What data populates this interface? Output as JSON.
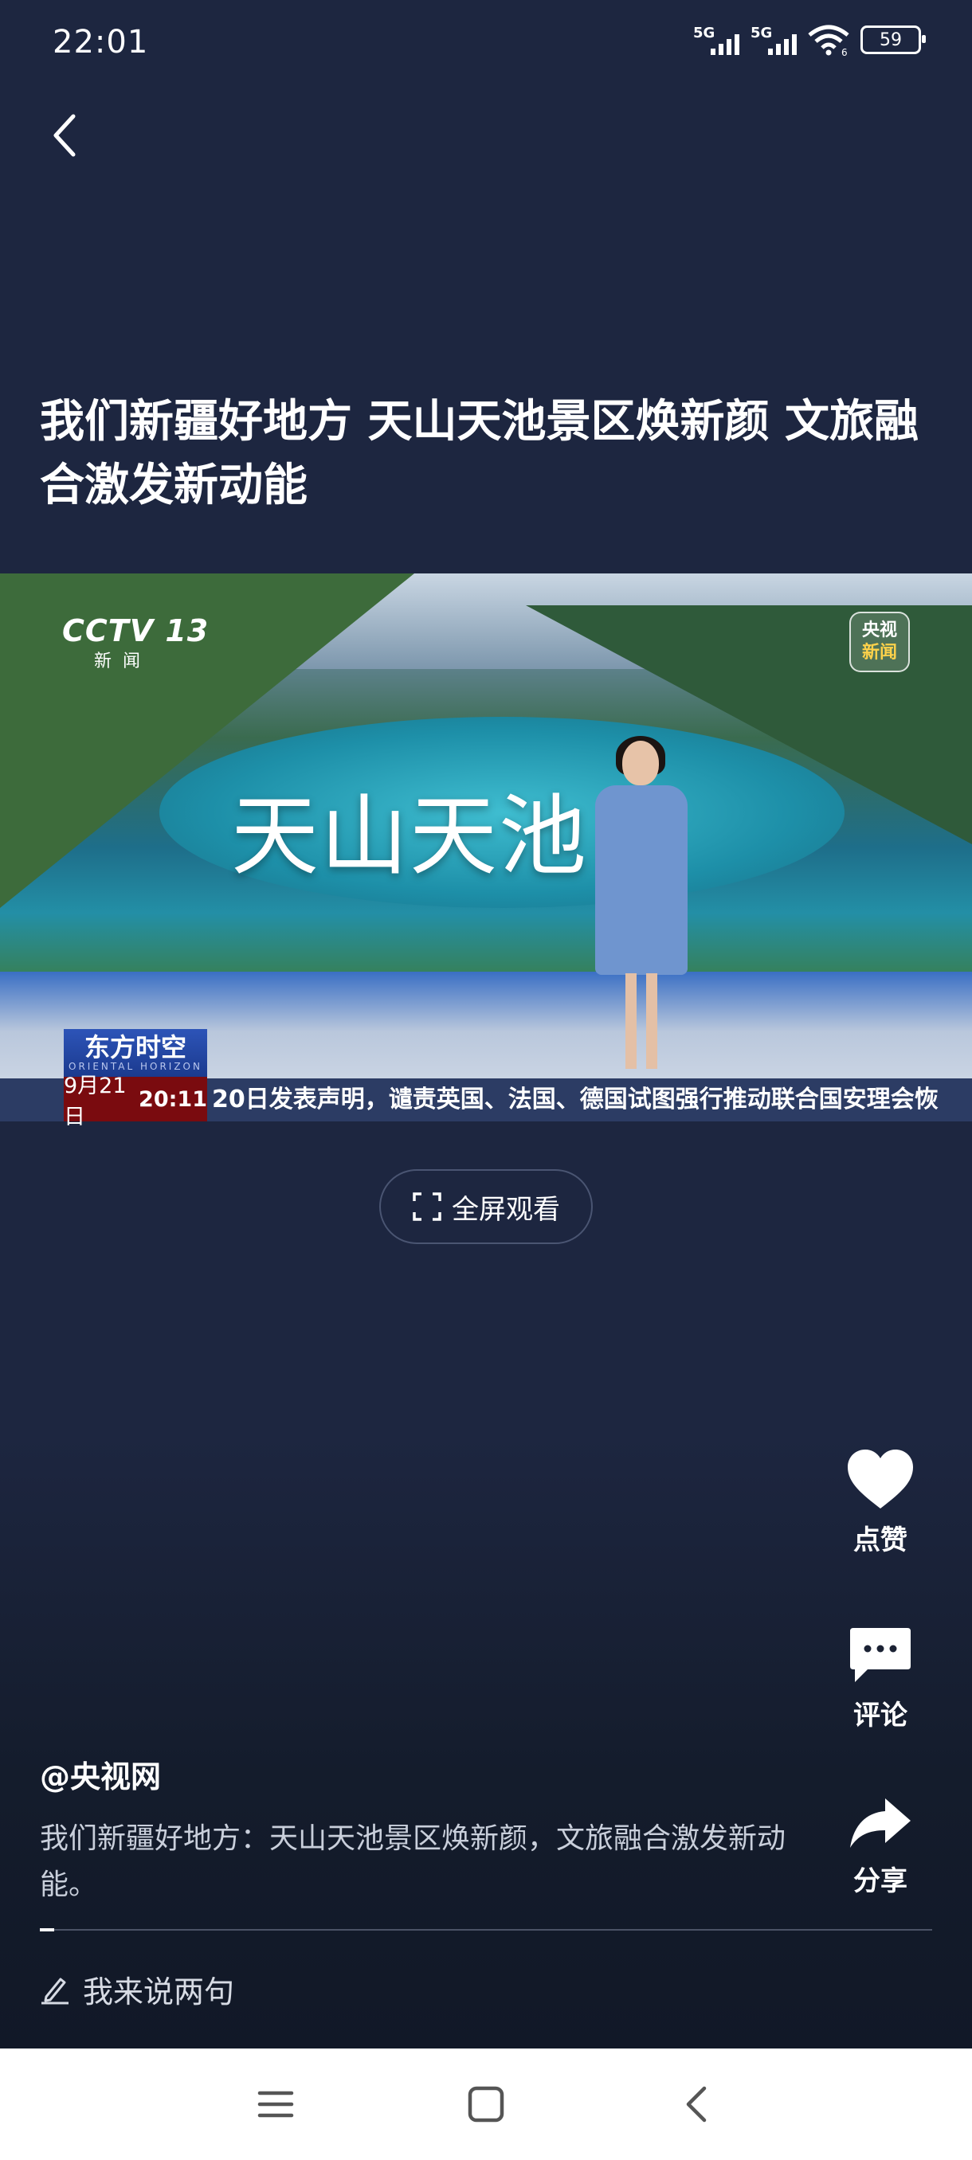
{
  "status_bar": {
    "time": "22:01",
    "signal1_label": "5G",
    "signal2_label": "5G",
    "wifi_badge": "6",
    "battery": "59"
  },
  "header": {
    "back_icon": "chevron-left-icon"
  },
  "article": {
    "title": "我们新疆好地方 天山天池景区焕新颜 文旅融合激发新动能"
  },
  "video": {
    "channel_logo": "CCTV 13",
    "channel_sub": "新闻",
    "badge_line1": "央视",
    "badge_line2": "新闻",
    "scene_title": "天山天池",
    "program_name": "东方时空",
    "program_en": "ORIENTAL HORIZON",
    "date": "9月21日",
    "clock": "20:11",
    "ticker": "20日发表声明，谴责英国、法国、德国试图强行推动联合国安理会恢"
  },
  "fullscreen_button": {
    "label": "全屏观看",
    "icon": "fullscreen-icon"
  },
  "actions": {
    "like_label": "点赞",
    "comment_label": "评论",
    "share_label": "分享"
  },
  "post": {
    "author": "@央视网",
    "description": "我们新疆好地方：天山天池景区焕新颜，文旅融合激发新动能。"
  },
  "comment_entry": {
    "placeholder": "我来说两句",
    "icon": "pencil-icon"
  },
  "nav": {
    "menu_icon": "menu-icon",
    "home_icon": "home-icon",
    "back_icon": "back-icon"
  }
}
